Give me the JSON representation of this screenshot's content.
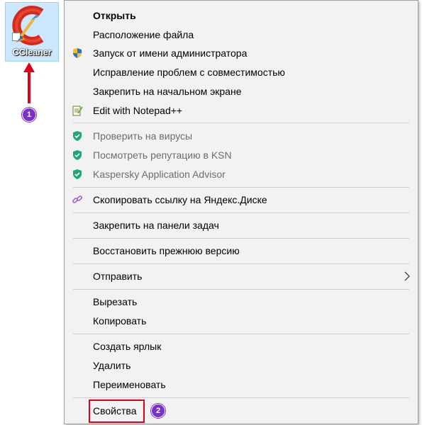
{
  "desktop": {
    "icon_label": "CCleaner",
    "icon_name": "ccleaner-icon"
  },
  "annotations": {
    "badge1": "1",
    "badge2": "2",
    "arrow_color": "#e0001b",
    "badge_color": "#7b2fd0",
    "highlight_color": "#e0001b"
  },
  "menu": {
    "open": "Открыть",
    "file_location": "Расположение файла",
    "run_as_admin": "Запуск от имени администратора",
    "troubleshoot_compat": "Исправление проблем с совместимостью",
    "pin_to_start": "Закрепить на начальном экране",
    "edit_notepad": "Edit with Notepad++",
    "scan_virus": "Проверить на вирусы",
    "check_ksn": "Посмотреть репутацию в KSN",
    "kaspersky_advisor": "Kaspersky Application Advisor",
    "copy_yandex_link": "Скопировать ссылку на Яндекс.Диске",
    "pin_taskbar": "Закрепить на панели задач",
    "restore_prev": "Восстановить прежнюю версию",
    "send_to": "Отправить",
    "cut": "Вырезать",
    "copy": "Копировать",
    "create_shortcut": "Создать ярлык",
    "delete": "Удалить",
    "rename": "Переименовать",
    "properties": "Свойства"
  }
}
